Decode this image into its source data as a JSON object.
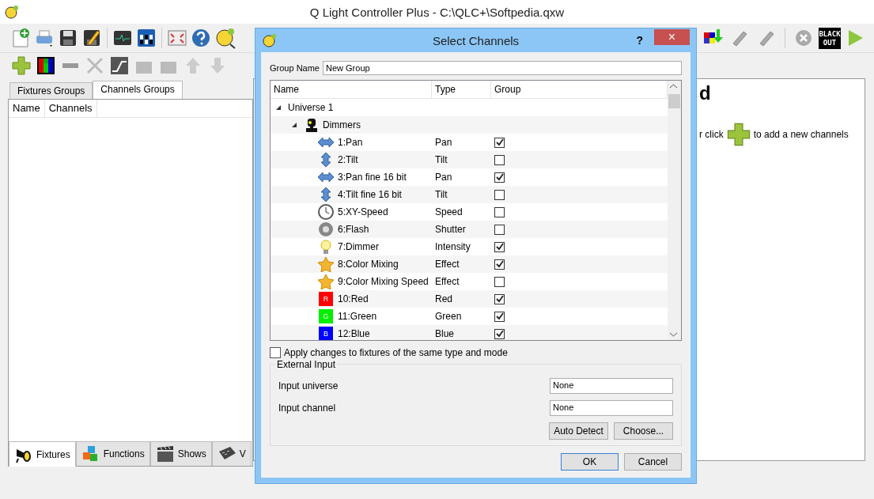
{
  "main_window": {
    "title": "Q Light Controller Plus - C:\\QLC+\\Softpedia.qxw",
    "blackout_label": "BLACK OUT"
  },
  "groups_tabs": [
    {
      "label": "Fixtures Groups",
      "selected": false
    },
    {
      "label": "Channels Groups",
      "selected": true
    }
  ],
  "groups_table": {
    "columns": [
      "Name",
      "Channels"
    ]
  },
  "help_panel": {
    "heading": "d",
    "line_start": "r click",
    "line_end": "to add a new channels"
  },
  "bottom_tabs": [
    {
      "label": "Fixtures",
      "selected": true
    },
    {
      "label": "Functions",
      "selected": false
    },
    {
      "label": "Shows",
      "selected": false
    },
    {
      "label": "V",
      "selected": false
    }
  ],
  "dialog": {
    "title": "Select Channels",
    "help_button": "?",
    "close_button": "×",
    "group_name": {
      "label": "Group Name",
      "value": "New Group"
    },
    "tree": {
      "columns": [
        "Name",
        "Type",
        "Group"
      ],
      "nodes": [
        {
          "kind": "universe",
          "label": "Universe 1",
          "expanded": true,
          "children": [
            {
              "kind": "fixture",
              "label": "Dimmers",
              "expanded": true,
              "children": [
                {
                  "kind": "channel",
                  "label": "1:Pan",
                  "type": "Pan",
                  "group": true
                },
                {
                  "kind": "channel",
                  "label": "2:Tilt",
                  "type": "Tilt",
                  "group": false
                },
                {
                  "kind": "channel",
                  "label": "3:Pan fine 16 bit",
                  "type": "Pan",
                  "group": true
                },
                {
                  "kind": "channel",
                  "label": "4:Tilt fine 16 bit",
                  "type": "Tilt",
                  "group": false
                },
                {
                  "kind": "channel",
                  "label": "5:XY-Speed",
                  "type": "Speed",
                  "group": false
                },
                {
                  "kind": "channel",
                  "label": "6:Flash",
                  "type": "Shutter",
                  "group": false
                },
                {
                  "kind": "channel",
                  "label": "7:Dimmer",
                  "type": "Intensity",
                  "group": true
                },
                {
                  "kind": "channel",
                  "label": "8:Color Mixing",
                  "type": "Effect",
                  "group": true
                },
                {
                  "kind": "channel",
                  "label": "9:Color Mixing Speed",
                  "type": "Effect",
                  "group": false
                },
                {
                  "kind": "channel",
                  "label": "10:Red",
                  "type": "Red",
                  "group": true,
                  "swatch": {
                    "letter": "R",
                    "color": "#ff0000"
                  }
                },
                {
                  "kind": "channel",
                  "label": "11:Green",
                  "type": "Green",
                  "group": true,
                  "swatch": {
                    "letter": "G",
                    "color": "#00ee00"
                  }
                },
                {
                  "kind": "channel",
                  "label": "12:Blue",
                  "type": "Blue",
                  "group": true,
                  "swatch": {
                    "letter": "B",
                    "color": "#0000ff"
                  }
                }
              ]
            }
          ]
        }
      ]
    },
    "apply_same": {
      "label": "Apply changes to fixtures of the same type and mode",
      "checked": false
    },
    "external_input": {
      "title": "External Input",
      "fields": [
        {
          "label": "Input universe",
          "value": "None"
        },
        {
          "label": "Input channel",
          "value": "None"
        }
      ],
      "buttons": [
        "Auto Detect",
        "Choose..."
      ]
    },
    "buttons": [
      {
        "label": "OK",
        "focused": true
      },
      {
        "label": "Cancel",
        "focused": false
      }
    ]
  }
}
